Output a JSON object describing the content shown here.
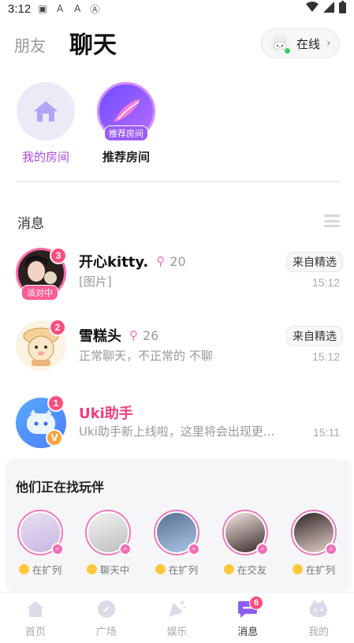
{
  "status_bar": {
    "time": "3:12"
  },
  "header": {
    "tabs": [
      {
        "label": "朋友"
      },
      {
        "label": "聊天"
      }
    ],
    "online_status": {
      "label": "在线"
    }
  },
  "rooms": [
    {
      "label": "我的房间"
    },
    {
      "label": "推荐房间",
      "tag": "推荐房间"
    }
  ],
  "messages": {
    "title": "消息",
    "items": [
      {
        "name": "开心kitty.",
        "level": "20",
        "preview": "[图片]",
        "tag": "来自精选",
        "time": "15:12",
        "unread": "3",
        "avatar_tag": "派对中"
      },
      {
        "name": "雪糕头",
        "level": "26",
        "preview": "正常聊天，不正常的 不聊",
        "tag": "来自精选",
        "time": "15:12",
        "unread": "2"
      },
      {
        "name": "Uki助手",
        "preview": "Uki助手新上线啦，这里将会出现更...",
        "time": "15:11",
        "unread": "1"
      }
    ]
  },
  "find_panel": {
    "title": "他们正在找玩伴",
    "users": [
      {
        "status": "在扩列"
      },
      {
        "status": "聊天中"
      },
      {
        "status": "在扩列"
      },
      {
        "status": "在交友"
      },
      {
        "status": "在扩列"
      }
    ]
  },
  "bottom_nav": {
    "items": [
      {
        "label": "首页",
        "icon": "home-icon"
      },
      {
        "label": "广场",
        "icon": "compass-icon"
      },
      {
        "label": "娱乐",
        "icon": "party-icon"
      },
      {
        "label": "消息",
        "icon": "message-icon",
        "badge": "6",
        "active": true
      },
      {
        "label": "我的",
        "icon": "profile-icon"
      }
    ]
  },
  "colors": {
    "accent_purple": "#b048e6",
    "badge_pink": "#ff4e7e",
    "uki_name": "#ee3f7b",
    "online_green": "#2ed36a"
  }
}
